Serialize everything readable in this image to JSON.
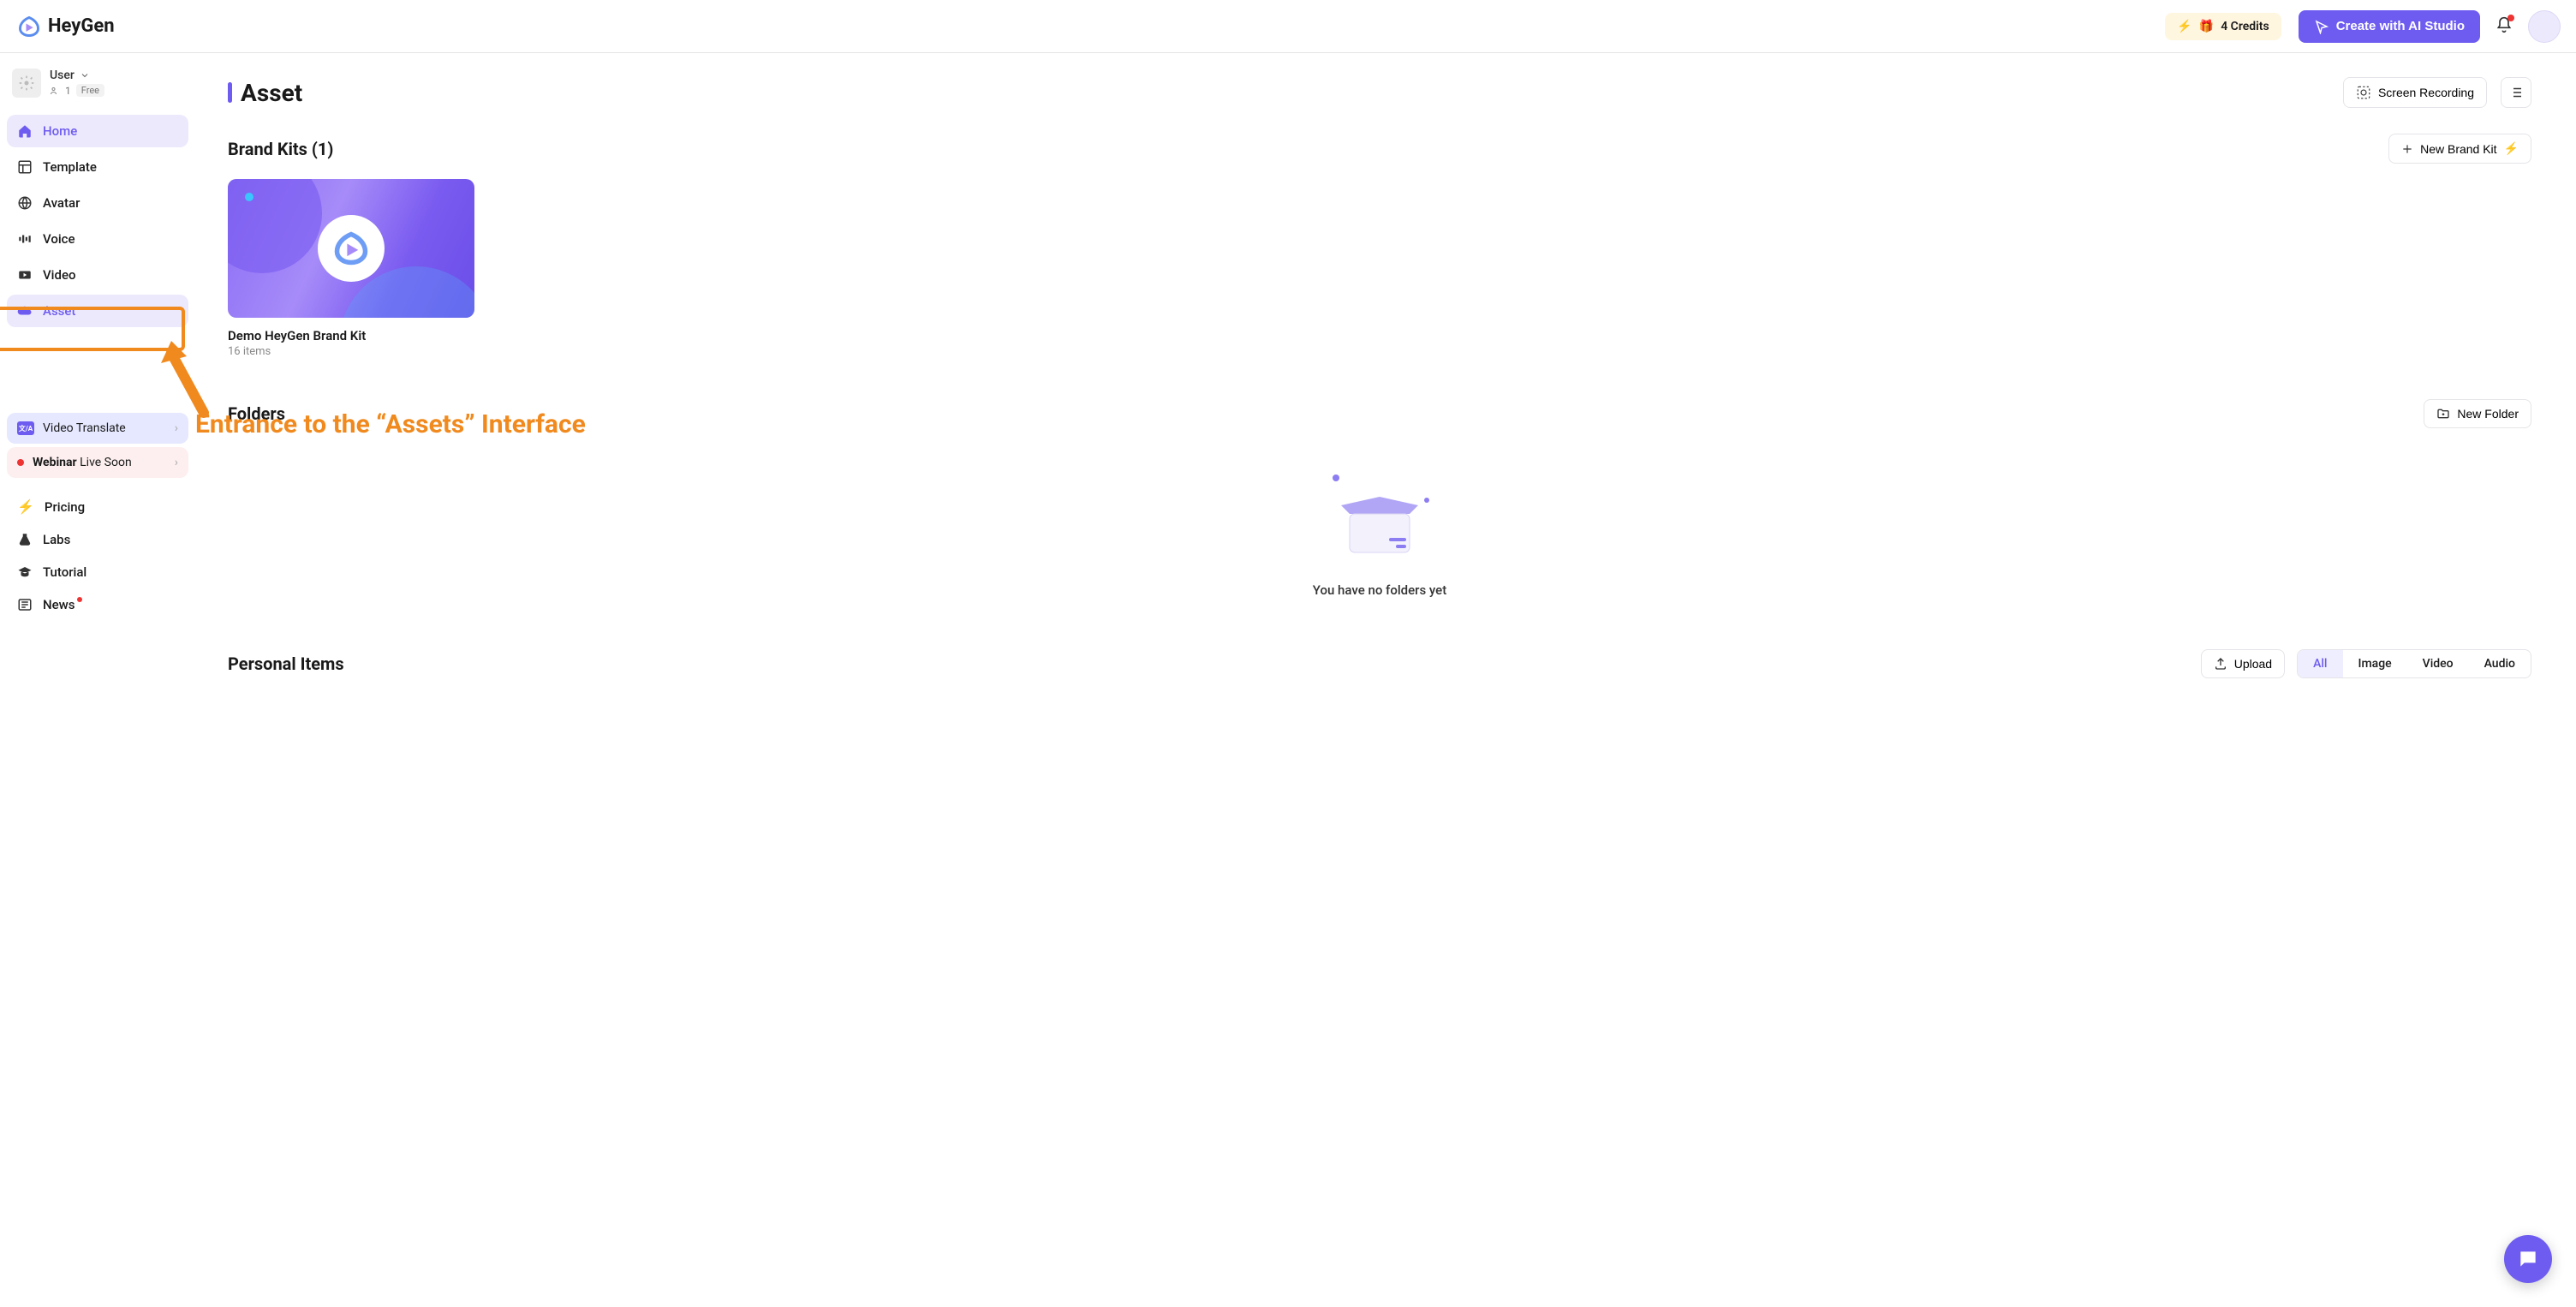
{
  "brand": "HeyGen",
  "header": {
    "credits_label": "4 Credits",
    "create_label": "Create with AI Studio"
  },
  "user": {
    "name": "User",
    "count": "1",
    "plan": "Free"
  },
  "sidebar": {
    "items": [
      {
        "label": "Home"
      },
      {
        "label": "Template"
      },
      {
        "label": "Avatar"
      },
      {
        "label": "Voice"
      },
      {
        "label": "Video"
      },
      {
        "label": "Asset"
      }
    ],
    "video_translate": "Video Translate",
    "webinar_strong": "Webinar",
    "webinar_rest": "Live Soon",
    "bottom": [
      {
        "label": "Pricing"
      },
      {
        "label": "Labs"
      },
      {
        "label": "Tutorial"
      },
      {
        "label": "News"
      }
    ]
  },
  "page": {
    "title": "Asset",
    "screen_recording": "Screen Recording",
    "brandkits_title": "Brand Kits (1)",
    "new_brandkit": "New Brand Kit",
    "brandkit_name": "Demo HeyGen Brand Kit",
    "brandkit_items": "16 items",
    "folders_title": "Folders",
    "new_folder": "New Folder",
    "no_folders": "You have no folders yet",
    "personal_title": "Personal Items",
    "upload": "Upload",
    "tabs": [
      "All",
      "Image",
      "Video",
      "Audio"
    ]
  },
  "annotation": "Entrance to the “Assets” Interface"
}
